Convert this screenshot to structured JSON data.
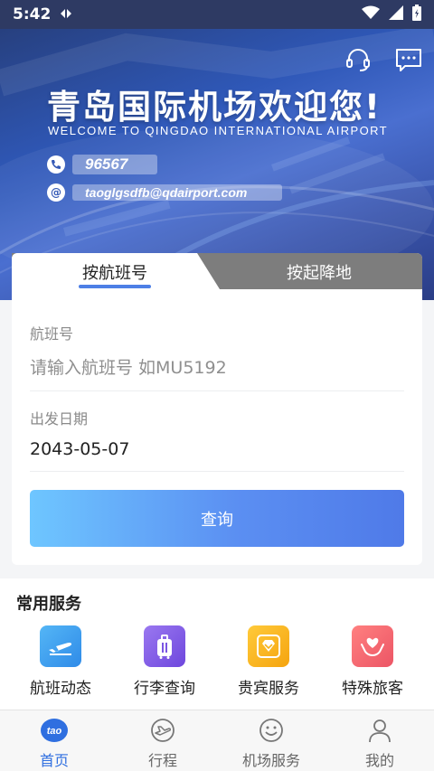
{
  "status_bar": {
    "time": "5:42"
  },
  "banner": {
    "title": "青岛国际机场欢迎您!",
    "subtitle": "WELCOME TO QINGDAO INTERNATIONAL AIRPORT",
    "phone": "96567",
    "email": "taoglgsdfb@qdairport.com",
    "email_icon": "@",
    "icons": [
      "headset-icon",
      "message-icon"
    ]
  },
  "search": {
    "tabs": [
      {
        "label": "按航班号",
        "active": true
      },
      {
        "label": "按起降地",
        "active": false
      }
    ],
    "flight_label": "航班号",
    "flight_placeholder": "请输入航班号 如MU5192",
    "date_label": "出发日期",
    "date_value": "2043-05-07",
    "query_label": "查询"
  },
  "services": {
    "title": "常用服务",
    "items": [
      {
        "label": "航班动态",
        "icon": "airplane-icon",
        "color": "#3fa0ee"
      },
      {
        "label": "行李查询",
        "icon": "luggage-icon",
        "color": "#8561e6"
      },
      {
        "label": "贵宾服务",
        "icon": "diamond-icon",
        "color": "#f5b21c"
      },
      {
        "label": "特殊旅客",
        "icon": "care-heart-icon",
        "color": "#f2666f"
      }
    ]
  },
  "bottom_nav": {
    "items": [
      {
        "label": "首页",
        "icon": "tao-home-icon",
        "active": true
      },
      {
        "label": "行程",
        "icon": "itinerary-icon",
        "active": false
      },
      {
        "label": "机场服务",
        "icon": "smiley-icon",
        "active": false
      },
      {
        "label": "我的",
        "icon": "profile-icon",
        "active": false
      }
    ]
  },
  "colors": {
    "accent": "#4d7fe6",
    "nav_active": "#2f6fe0",
    "banner": "#2f58b8"
  }
}
